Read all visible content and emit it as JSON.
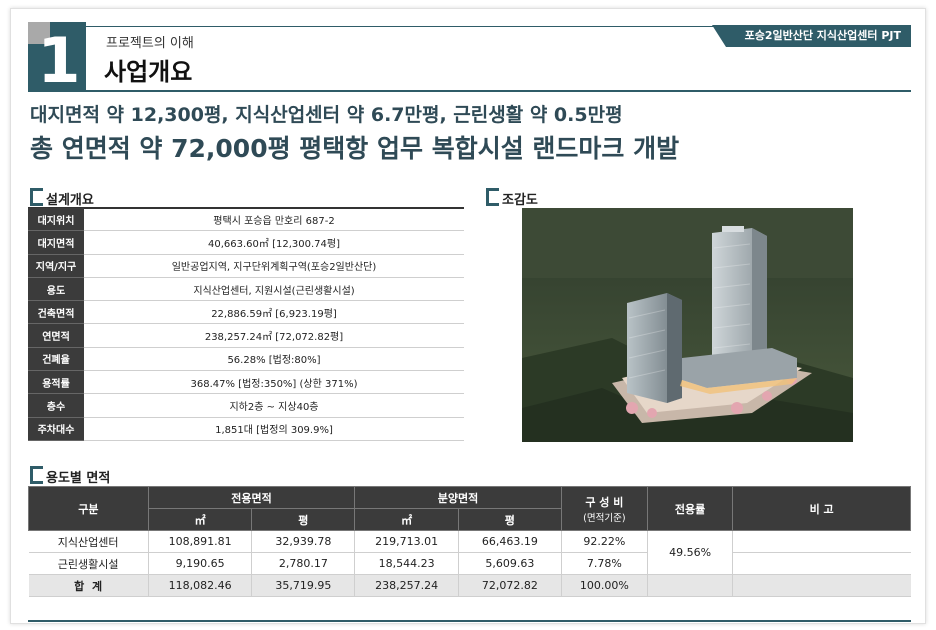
{
  "header": {
    "number": "1",
    "subtitle": "프로젝트의 이해",
    "title": "사업개요",
    "tag": "포승2일반산단 지식산업센터 PJT"
  },
  "headline": {
    "line1": "대지면적 약 12,300평, 지식산업센터 약 6.7만평, 근린생활 약 0.5만평",
    "line2": "총 연면적 약 72,000평 평택항 업무 복합시설 랜드마크 개발"
  },
  "design": {
    "title": "설계개요",
    "rows": [
      {
        "key": "대지위치",
        "value": "평택시 포승읍 만호리 687-2"
      },
      {
        "key": "대지면적",
        "value": "40,663.60㎡ [12,300.74평]"
      },
      {
        "key": "지역/지구",
        "value": "일반공업지역, 지구단위계획구역(포승2일반산단)"
      },
      {
        "key": "용도",
        "value": "지식산업센터, 지원시설(근린생활시설)"
      },
      {
        "key": "건축면적",
        "value": "22,886.59㎡ [6,923.19평]"
      },
      {
        "key": "연면적",
        "value": "238,257.24㎡ [72,072.82평]"
      },
      {
        "key": "건폐율",
        "value": "56.28% [법정:80%]"
      },
      {
        "key": "용적률",
        "value": "368.47% [법정:350%] (상한 371%)"
      },
      {
        "key": "층수",
        "value": "지하2층 ~ 지상40층"
      },
      {
        "key": "주차대수",
        "value": "1,851대 [법정의 309.9%]"
      }
    ]
  },
  "bird_eye": {
    "title": "조감도"
  },
  "area": {
    "title": "용도별 면적",
    "headers": {
      "category": "구분",
      "exclusive": "전용면적",
      "sale": "분양면적",
      "ratio": "구 성 비",
      "ratio_sub": "(면적기준)",
      "exclusive_rate": "전용률",
      "note": "비 고",
      "sqm": "㎡",
      "pyeong": "평"
    },
    "rows": [
      {
        "name": "지식산업센터",
        "ex_sqm": "108,891.81",
        "ex_py": "32,939.78",
        "sa_sqm": "219,713.01",
        "sa_py": "66,463.19",
        "ratio": "92.22%"
      },
      {
        "name": "근린생활시설",
        "ex_sqm": "9,190.65",
        "ex_py": "2,780.17",
        "sa_sqm": "18,544.23",
        "sa_py": "5,609.63",
        "ratio": "7.78%"
      }
    ],
    "exclusive_rate_value": "49.56%",
    "total": {
      "name": "합  계",
      "ex_sqm": "118,082.46",
      "ex_py": "35,719.95",
      "sa_sqm": "238,257.24",
      "sa_py": "72,072.82",
      "ratio": "100.00%"
    }
  }
}
